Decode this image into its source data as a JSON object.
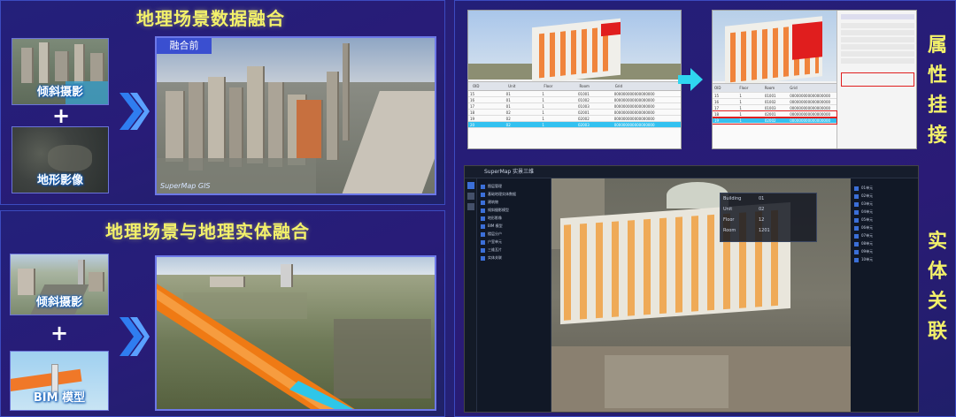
{
  "top_left": {
    "title": "地理场景数据融合",
    "thumb1_label": "倾斜摄影",
    "thumb2_label": "地形影像",
    "plus": "+",
    "badge": "融合前",
    "watermark": "SuperMap GIS"
  },
  "bottom_left": {
    "title": "地理场景与地理实体融合",
    "thumb1_label": "倾斜摄影",
    "thumb2_label": "BIM 模型",
    "plus": "+"
  },
  "right": {
    "section1": "属性挂接",
    "section2": "实体关联",
    "chars1": [
      "属",
      "性",
      "挂",
      "接"
    ],
    "chars2": [
      "实",
      "体",
      "关",
      "联"
    ],
    "table_headers": [
      "OID",
      "Unit",
      "Floor",
      "Room",
      "Grid"
    ],
    "table_rows": [
      [
        "15",
        "01",
        "1",
        "01001",
        "000000000000000000"
      ],
      [
        "16",
        "01",
        "1",
        "01002",
        "000000000000000000"
      ],
      [
        "17",
        "01",
        "1",
        "01003",
        "000000000000000000"
      ],
      [
        "18",
        "02",
        "1",
        "02001",
        "000000000000000000"
      ],
      [
        "19",
        "02",
        "1",
        "02002",
        "000000000000000000"
      ],
      [
        "20",
        "02",
        "1",
        "02003",
        "000000000000000000"
      ]
    ],
    "app_title": "SuperMap 实景三维",
    "attr_keys": [
      "Building",
      "Unit",
      "Floor",
      "Room"
    ],
    "attr_vals": [
      "01",
      "02",
      "12",
      "1201"
    ],
    "tree_items": [
      "图层管理",
      "基础地理实体数据",
      "建筑物",
      "倾斜摄影模型",
      "地形影像",
      "BIM 模型",
      "楼层分户",
      "户室单元",
      "三维瓦片",
      "实体关联"
    ],
    "list_items": [
      "01单元",
      "02单元",
      "03单元",
      "04单元",
      "05单元",
      "06单元",
      "07单元",
      "08单元",
      "09单元",
      "10单元"
    ]
  },
  "colors": {
    "title_yellow": "#f3f16a",
    "arrow_blue": "#2f7df0",
    "arrow_cyan": "#2fd6f0",
    "panel_border": "#3c4bc0",
    "highlight_red": "#e01e1e"
  }
}
